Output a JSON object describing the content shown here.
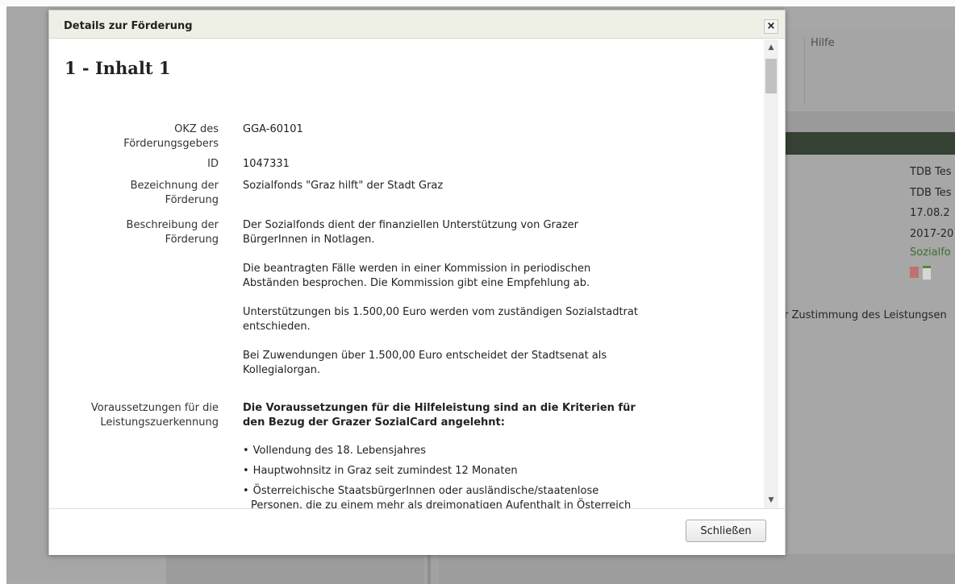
{
  "background": {
    "menu_help": "Hilfe",
    "values": [
      "TDB Tes",
      "TDB Tes",
      "17.08.2",
      "2017-20"
    ],
    "link_text": "Sozialfo",
    "consent_text": "r Zustimmung des Leistungsen",
    "icons": [
      "pdf-icon",
      "document-icon"
    ]
  },
  "dialog": {
    "title": "Details zur Förderung",
    "close_icon": "×",
    "heading": "1 - Inhalt 1",
    "fields": {
      "okz": {
        "label_line1": "OKZ des",
        "label_line2": "Förderungsgebers",
        "value": "GGA-60101"
      },
      "id": {
        "label": "ID",
        "value": "1047331"
      },
      "bezeichnung": {
        "label_line1": "Bezeichnung der",
        "label_line2": "Förderung",
        "value": "Sozialfonds \"Graz hilft\" der Stadt Graz"
      },
      "beschreibung": {
        "label_line1": "Beschreibung der",
        "label_line2": "Förderung",
        "paragraphs": [
          [
            "Der Sozialfonds dient der finanziellen Unterstützung von Grazer",
            "BürgerInnen in Notlagen."
          ],
          [
            "Die beantragten Fälle werden in einer Kommission in periodischen",
            "Abständen besprochen. Die Kommission gibt eine Empfehlung ab."
          ],
          [
            "Unterstützungen bis 1.500,00 Euro werden vom zuständigen Sozialstadtrat",
            "entschieden."
          ],
          [
            "Bei Zuwendungen über 1.500,00 Euro entscheidet der Stadtsenat als",
            "Kollegialorgan."
          ]
        ]
      },
      "voraussetzungen": {
        "label_line1": "Voraussetzungen für die",
        "label_line2": "Leistungszuerkennung",
        "intro_line1": "Die Voraussetzungen für die Hilfeleistung sind an die Kriterien für",
        "intro_line2": "den Bezug der Grazer SozialCard angelehnt:",
        "bullets": [
          "Vollendung des 18. Lebensjahres",
          "Hauptwohnsitz in Graz seit zumindest 12 Monaten",
          "Österreichische StaatsbürgerInnen oder ausländische/staatenlose"
        ],
        "bullet_continuation": "Personen, die zu einem mehr als dreimonatigen Aufenthalt in Österreich"
      }
    },
    "scroll_up": "▲",
    "scroll_down": "▼",
    "close_button": "Schließen"
  }
}
